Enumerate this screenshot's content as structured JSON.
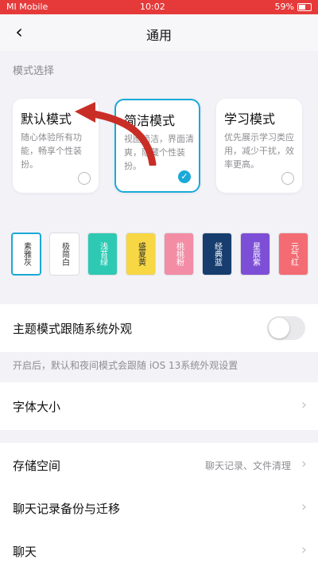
{
  "status": {
    "carrier": "MI Mobile",
    "time": "10:02",
    "battery": "59%"
  },
  "header": {
    "back_icon": "chevron-left-icon",
    "title": "通用"
  },
  "mode_section": {
    "label": "模式选择",
    "cards": [
      {
        "title": "默认模式",
        "desc": "随心体验所有功能，畅享个性装扮。",
        "selected": false
      },
      {
        "title": "简洁模式",
        "desc": "视图简洁，界面清爽，隐藏个性装扮。",
        "selected": true
      },
      {
        "title": "学习模式",
        "desc": "优先展示学习类应用，减少干扰，效率更高。",
        "selected": false
      }
    ]
  },
  "themes": [
    {
      "label": "素雅灰",
      "color": "#ffffff",
      "text_color": "#333333",
      "selected": true
    },
    {
      "label": "极简白",
      "color": "#ffffff",
      "text_color": "#333333",
      "selected": false
    },
    {
      "label": "浅苔绿",
      "color": "#2ec9b3",
      "text_color": "#ffffff",
      "selected": false
    },
    {
      "label": "盛夏黄",
      "color": "#f7d743",
      "text_color": "#333333",
      "selected": false
    },
    {
      "label": "桃桃粉",
      "color": "#f38ca5",
      "text_color": "#ffffff",
      "selected": false
    },
    {
      "label": "经典蓝",
      "color": "#173d6e",
      "text_color": "#ffffff",
      "selected": false
    },
    {
      "label": "星辰紫",
      "color": "#7d4fd6",
      "text_color": "#ffffff",
      "selected": false
    },
    {
      "label": "元气红",
      "color": "#f36b73",
      "text_color": "#ffffff",
      "selected": false
    }
  ],
  "follow_system": {
    "label": "主题模式跟随系统外观",
    "enabled": false
  },
  "follow_hint": "开启后，默认和夜间模式会跟随 iOS 13系统外观设置",
  "font_size": {
    "label": "字体大小"
  },
  "storage": {
    "label": "存储空间",
    "detail": "聊天记录、文件清理"
  },
  "backup": {
    "label": "聊天记录备份与迁移"
  },
  "chat": {
    "label": "聊天"
  },
  "colors": {
    "accent": "#1aa9d8",
    "status_bar": "#e63a3a",
    "background": "#f2f2f7"
  }
}
